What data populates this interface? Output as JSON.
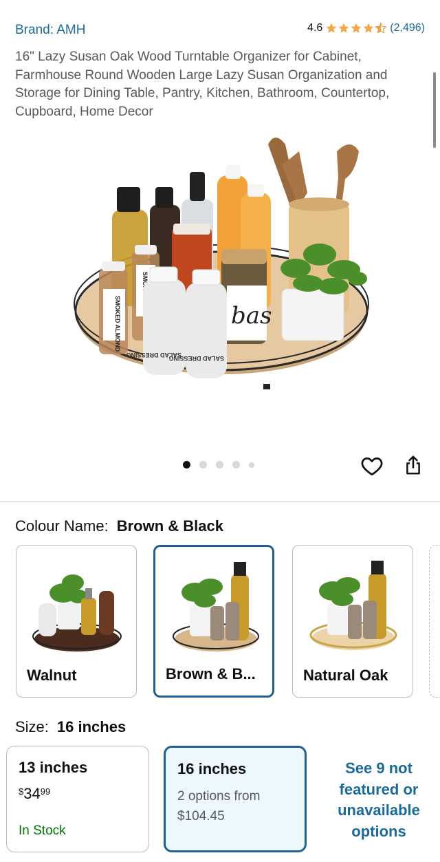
{
  "product": {
    "brand": "Brand: AMH",
    "rating": "4.6",
    "rating_stars": 4.5,
    "rating_count": "(2,496)",
    "title": "16\" Lazy Susan Oak Wood Turntable Organizer for Cabinet, Farmhouse Round Wooden Large Lazy Susan Organization and Storage for Dining Table, Pantry, Kitchen, Bathroom, Countertop, Cupboard, Home Decor",
    "image_labels": [
      "SMOKED ALMOND",
      "SMOKED ALMOND",
      "SALAD DRESSING",
      "SALAD DRESSING",
      "bas"
    ]
  },
  "gallery": {
    "image_count": 5,
    "active_index": 0
  },
  "colour": {
    "label": "Colour Name:",
    "selected": "Brown & Black",
    "options": [
      {
        "label": "Walnut"
      },
      {
        "label": "Brown & B..."
      },
      {
        "label": "Natural Oak"
      }
    ]
  },
  "size": {
    "label": "Size:",
    "selected": "16 inches",
    "options": [
      {
        "name": "13 inches",
        "currency": "$",
        "whole": "34",
        "fraction": "99",
        "stock": "In Stock"
      },
      {
        "name": "16 inches",
        "options_line": "2 options from",
        "price": "$104.45"
      }
    ],
    "see_more": "See 9 not featured or unavailable options"
  },
  "colors": {
    "link": "#1a6a9a",
    "star": "#f3a847",
    "selected_border": "#1f5f95",
    "in_stock": "#007600"
  },
  "icons": [
    "star-icon",
    "heart-icon",
    "share-icon"
  ]
}
